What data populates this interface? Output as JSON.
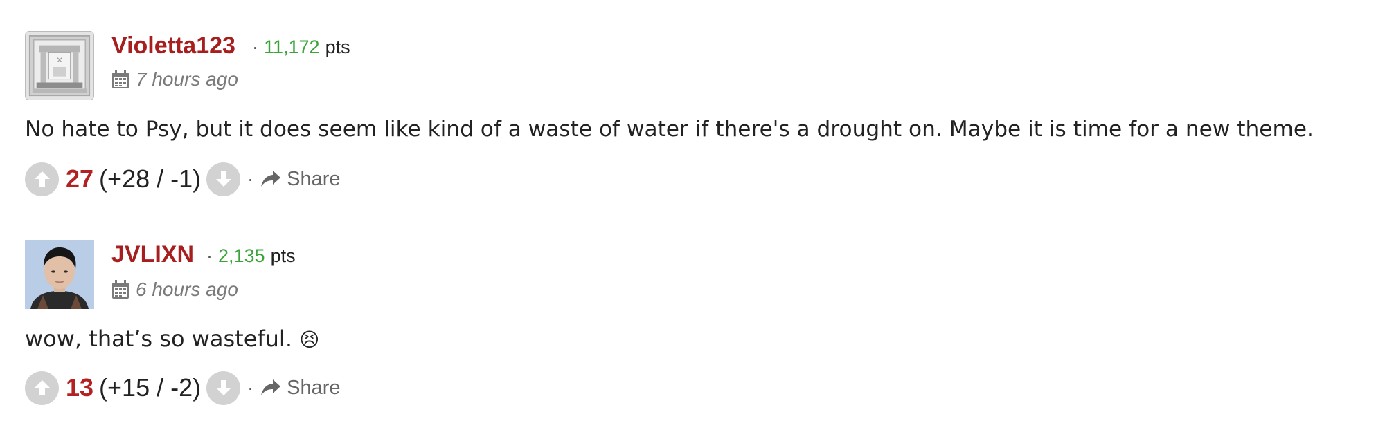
{
  "comments": [
    {
      "username": "Violetta123",
      "points_value": "11,172",
      "points_unit": "pts",
      "separator": "·",
      "time": "7 hours ago",
      "body": "No hate to Psy, but it does seem like kind of a waste of water if there's a drought on. Maybe it is time for a new theme.",
      "score": "27",
      "breakdown": "(+28 / -1)",
      "share_label": "Share",
      "avatar_icon": "building-emblem-avatar"
    },
    {
      "username": "JVLIXN",
      "points_value": "2,135",
      "points_unit": "pts",
      "separator": "·",
      "time": "6 hours ago",
      "body": "wow, that’s so wasteful.",
      "emoji": "😣",
      "score": "13",
      "breakdown": "(+15 / -2)",
      "share_label": "Share",
      "avatar_icon": "person-photo-avatar"
    }
  ],
  "colors": {
    "username": "#a61e1e",
    "points": "#3aa43a",
    "score": "#b22222",
    "muted": "#7a7a7a",
    "vote_bg": "#d2d2d2"
  }
}
